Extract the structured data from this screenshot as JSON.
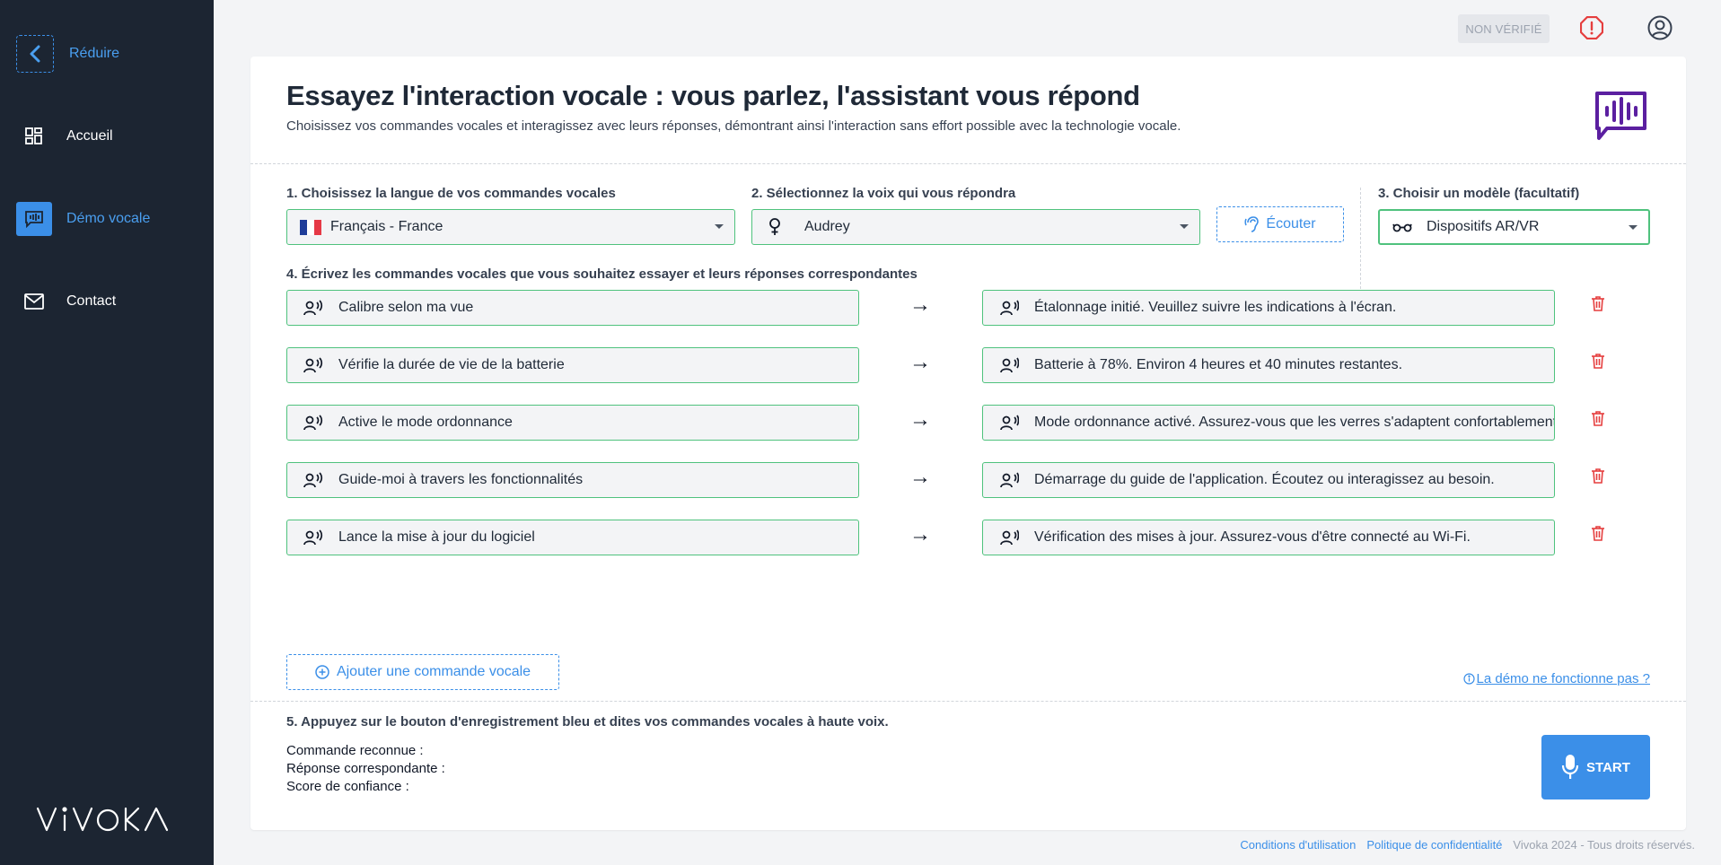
{
  "sidebar": {
    "collapse_label": "Réduire",
    "items": [
      {
        "label": "Accueil",
        "icon": "dashboard-icon",
        "active": false
      },
      {
        "label": "Démo vocale",
        "icon": "voice-chat-icon",
        "active": true
      },
      {
        "label": "Contact",
        "icon": "mail-icon",
        "active": false
      }
    ],
    "logo_text": "VIVOKA"
  },
  "topbar": {
    "badge": "NON VÉRIFIÉ",
    "alert_icon": "alert-circle-icon",
    "user_icon": "user-circle-icon"
  },
  "header": {
    "title": "Essayez l'interaction vocale : vous parlez, l'assistant vous répond",
    "subtitle": "Choisissez vos commandes vocales et interagissez avec leurs réponses, démontrant ainsi l'interaction sans effort possible avec la technologie vocale."
  },
  "step1": {
    "label": "1. Choisissez la langue de vos commandes vocales",
    "value": "Français - France"
  },
  "step2": {
    "label": "2. Sélectionnez la voix qui vous répondra",
    "value": "Audrey",
    "listen_label": "Écouter"
  },
  "step3": {
    "label": "3. Choisir un modèle (facultatif)",
    "value": "Dispositifs AR/VR"
  },
  "step4": {
    "label": "4. Écrivez les commandes vocales que vous souhaitez essayer et leurs réponses correspondantes",
    "arrow": "→",
    "commands": [
      {
        "command": "Calibre selon ma vue",
        "response": "Étalonnage initié. Veuillez suivre les indications à l'écran."
      },
      {
        "command": "Vérifie la durée de vie de la batterie",
        "response": "Batterie à 78%. Environ 4 heures et 40 minutes restantes."
      },
      {
        "command": "Active le mode ordonnance",
        "response": "Mode ordonnance activé. Assurez-vous que les verres s'adaptent confortablement."
      },
      {
        "command": "Guide-moi à travers les fonctionnalités",
        "response": "Démarrage du guide de l'application. Écoutez ou interagissez au besoin."
      },
      {
        "command": "Lance la mise à jour du logiciel",
        "response": "Vérification des mises à jour. Assurez-vous d'être connecté au Wi-Fi."
      }
    ],
    "add_label": "Ajouter une commande vocale",
    "help_link": "La démo ne fonctionne pas ?"
  },
  "step5": {
    "label": "5. Appuyez sur le bouton d'enregistrement bleu et dites vos commandes vocales à haute voix.",
    "recognized": "Commande reconnue :",
    "response": "Réponse correspondante :",
    "score": "Score de confiance :",
    "start_label": "START"
  },
  "footer": {
    "terms": "Conditions d'utilisation",
    "privacy": "Politique de confidentialité",
    "copyright": "Vivoka 2024 - Tous droits réservés."
  },
  "colors": {
    "sidebar_bg": "#1c2532",
    "accent": "#3b8fe8",
    "field_border": "#4fc27d",
    "danger": "#e53e3e",
    "brand_purple": "#5b1fa0"
  }
}
